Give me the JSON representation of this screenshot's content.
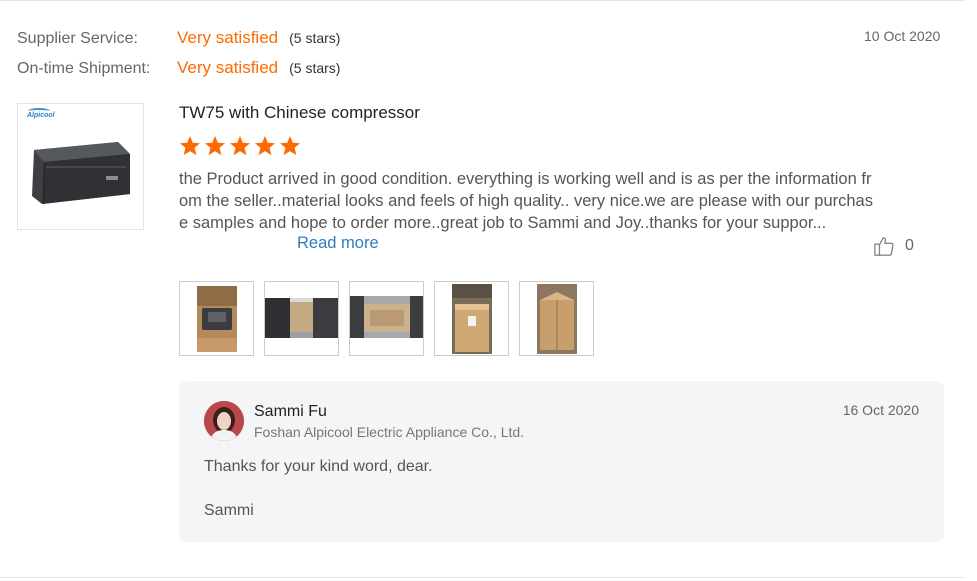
{
  "ratings": [
    {
      "label": "Supplier Service:",
      "value": "Very satisfied",
      "stars": "(5 stars)"
    },
    {
      "label": "On-time Shipment:",
      "value": "Very satisfied",
      "stars": "(5 stars)"
    }
  ],
  "review": {
    "date": "10 Oct 2020",
    "product_brand": "Alpicool",
    "product_title": "TW75 with Chinese compressor",
    "star_rating": 5,
    "star_color": "#ff6a00",
    "text": "the Product arrived in good condition. everything is working well and is as per the information from the seller..material looks and feels of high quality.. very nice.we are please with our purchase samples and hope to order more..great job to Sammi and Joy..thanks for your suppor...",
    "read_more": "Read more",
    "likes": "0",
    "photos": [
      "photo-1",
      "photo-2",
      "photo-3",
      "photo-4",
      "photo-5"
    ]
  },
  "reply": {
    "name": "Sammi Fu",
    "company": "Foshan Alpicool Electric Appliance Co., Ltd.",
    "date": "16 Oct 2020",
    "text": "Thanks for your kind word, dear.",
    "signature": "Sammi"
  },
  "colors": {
    "accent": "#ff6a00",
    "link": "#2f7dc1",
    "reply_bg": "#f4f5f7"
  }
}
